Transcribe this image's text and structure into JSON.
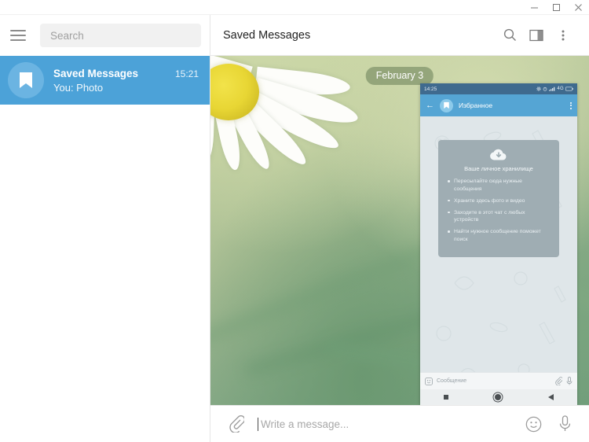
{
  "window": {
    "minimize_label": "Minimize",
    "maximize_label": "Maximize",
    "close_label": "Close"
  },
  "sidebar": {
    "menu_icon": "hamburger-menu-icon",
    "search": {
      "placeholder": "Search"
    },
    "chats": [
      {
        "avatar_icon": "bookmark-icon",
        "name": "Saved Messages",
        "time": "15:21",
        "preview": "You: Photo",
        "selected": true
      }
    ]
  },
  "chat": {
    "title": "Saved Messages",
    "icons": [
      "search-icon",
      "sidebar-toggle-icon",
      "more-options-icon"
    ],
    "date_divider": "February 3",
    "attachment_type": "photo"
  },
  "phone_screenshot": {
    "status": {
      "time": "14:25",
      "network": "4G",
      "icons": [
        "gear-icon",
        "alarm-icon",
        "signal-icon",
        "battery-icon"
      ]
    },
    "header": {
      "back_icon": "back-arrow-icon",
      "avatar_icon": "bookmark-icon",
      "title": "Избранное",
      "menu_icon": "more-options-icon"
    },
    "card": {
      "icon": "cloud-download-icon",
      "title": "Ваше личное хранилище",
      "bullets": [
        "Пересылайте сюда нужные сообщения",
        "Храните здесь фото и видео",
        "Заходите в этот чат с любых устройств",
        "Найти нужное сообщение поможет поиск"
      ]
    },
    "input": {
      "emoji_icon": "smiley-icon",
      "placeholder": "Сообщение",
      "attach_icon": "paperclip-icon",
      "mic_icon": "microphone-icon"
    },
    "navbar": [
      "recents-square-icon",
      "home-circle-icon",
      "back-triangle-icon"
    ]
  },
  "composer": {
    "attach_icon": "paperclip-icon",
    "placeholder": "Write a message...",
    "emoji_icon": "smiley-icon",
    "mic_icon": "microphone-icon"
  },
  "colors": {
    "accent": "#4ca2d8",
    "phone_header": "#55a5d4",
    "phone_status": "#3f6a8e",
    "date_badge": "#73875f",
    "card": "#9fadb3"
  }
}
